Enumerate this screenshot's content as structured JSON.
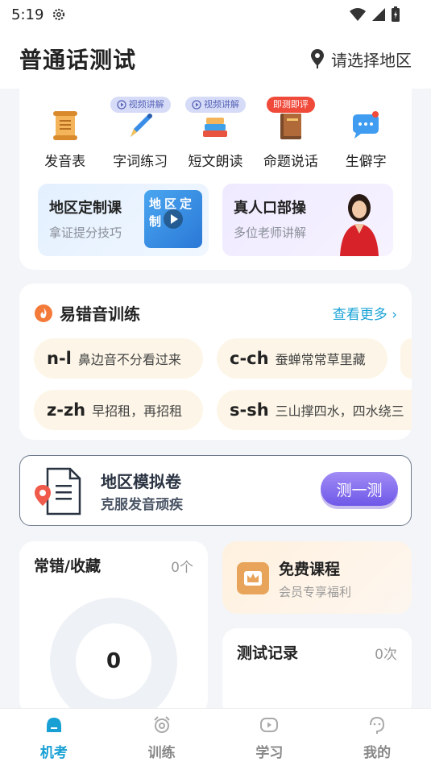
{
  "status": {
    "time": "5:19"
  },
  "header": {
    "title": "普通话测试",
    "region": "请选择地区"
  },
  "features": [
    {
      "label": "发音表",
      "icon": "scroll-icon",
      "tag": ""
    },
    {
      "label": "字词练习",
      "icon": "pen-icon",
      "tag": "视频讲解"
    },
    {
      "label": "短文朗读",
      "icon": "books-icon",
      "tag": "视频讲解"
    },
    {
      "label": "命题说话",
      "icon": "book-icon",
      "tag": "即测即评"
    },
    {
      "label": "生僻字",
      "icon": "chat-bubble-icon",
      "tag": ""
    }
  ],
  "courses": [
    {
      "title": "地区定制课",
      "subtitle": "拿证提分技巧",
      "thumb_text": "地区定制"
    },
    {
      "title": "真人口部操",
      "subtitle": "多位老师讲解"
    }
  ],
  "drill": {
    "title": "易错音训练",
    "more": "查看更多 ›",
    "items": [
      {
        "key": "n-l",
        "text": "鼻边音不分看过来"
      },
      {
        "key": "c-ch",
        "text": "蚕蝉常常草里藏"
      },
      {
        "key": "z-zh",
        "text": "早招租，再招租"
      },
      {
        "key": "s-sh",
        "text": "三山撑四水，四水绕三"
      }
    ]
  },
  "mock": {
    "title": "地区模拟卷",
    "subtitle": "克服发音顽疾",
    "button": "测一测"
  },
  "errors": {
    "title": "常错/收藏",
    "count": "0个",
    "value": "0"
  },
  "free": {
    "title": "免费课程",
    "subtitle": "会员专享福利"
  },
  "record": {
    "title": "测试记录",
    "count": "0次"
  },
  "tabs": [
    {
      "label": "机考",
      "active": true
    },
    {
      "label": "训练",
      "active": false
    },
    {
      "label": "学习",
      "active": false
    },
    {
      "label": "我的",
      "active": false
    }
  ],
  "colors": {
    "accent": "#18a0d4",
    "button": "#7a64ee"
  }
}
